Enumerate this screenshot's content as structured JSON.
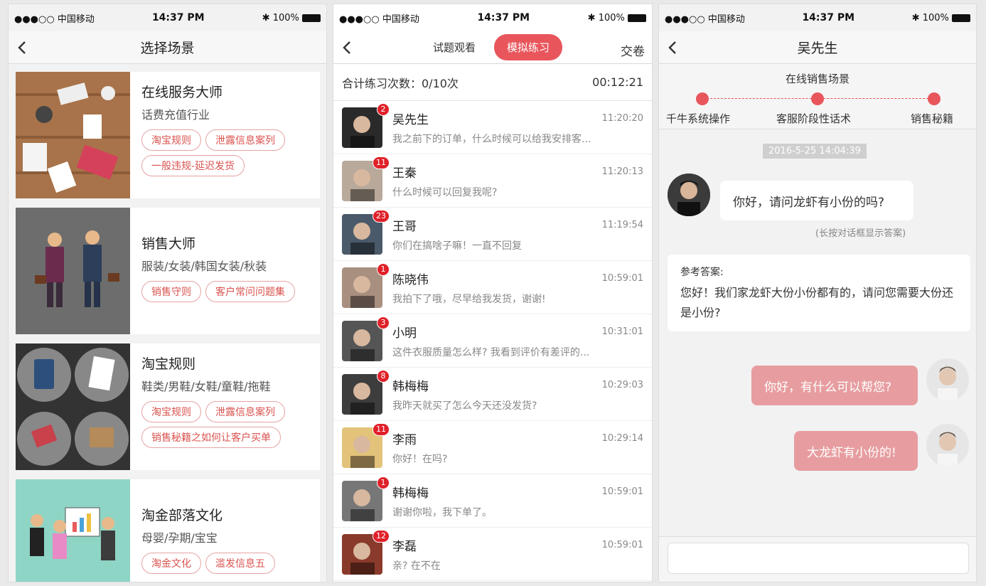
{
  "status": {
    "signal": "●●●○○ 中国移动",
    "time": "14:37 PM",
    "battery": "100%"
  },
  "panel1": {
    "title": "选择场景",
    "cards": [
      {
        "title": "在线服务大师",
        "sub": "话费充值行业",
        "tags": [
          "淘宝规则",
          "泄露信息案列",
          "一般违规-延迟发货"
        ]
      },
      {
        "title": "销售大师",
        "sub": "服装/女装/韩国女装/秋装",
        "tags": [
          "销售守则",
          "客户常问问题集"
        ]
      },
      {
        "title": "淘宝规则",
        "sub": "鞋类/男鞋/女鞋/童鞋/拖鞋",
        "tags": [
          "淘宝规则",
          "泄露信息案列",
          "销售秘籍之如何让客户买单"
        ]
      },
      {
        "title": "淘金部落文化",
        "sub": "母婴/孕期/宝宝",
        "tags": [
          "淘金文化",
          "滥发信息五"
        ]
      }
    ]
  },
  "panel2": {
    "tab1": "试题观看",
    "tab2": "模拟练习",
    "submit": "交卷",
    "count": "合计练习次数：0/10次",
    "timer": "00:12:21",
    "contacts": [
      {
        "name": "吴先生",
        "time": "11:20:20",
        "msg": "我之前下的订单，什么时候可以给我安排客...",
        "badge": "2"
      },
      {
        "name": "王秦",
        "time": "11:20:13",
        "msg": "什么时候可以回复我呢?",
        "badge": "11"
      },
      {
        "name": "王哥",
        "time": "11:19:54",
        "msg": "你们在搞啥子嘛！一直不回复",
        "badge": "23"
      },
      {
        "name": "陈晓伟",
        "time": "10:59:01",
        "msg": "我拍下了哦，尽早给我发货，谢谢!",
        "badge": "1"
      },
      {
        "name": "小明",
        "time": "10:31:01",
        "msg": "这件衣服质量怎么样? 我看到评价有差评的...",
        "badge": "3"
      },
      {
        "name": "韩梅梅",
        "time": "10:29:03",
        "msg": "我昨天就买了怎么今天还没发货?",
        "badge": "8"
      },
      {
        "name": "李雨",
        "time": "10:29:14",
        "msg": "你好！在吗?",
        "badge": "11"
      },
      {
        "name": "韩梅梅",
        "time": "10:59:01",
        "msg": "谢谢你啦，我下单了。",
        "badge": "1"
      },
      {
        "name": "李磊",
        "time": "10:59:01",
        "msg": "亲? 在不在",
        "badge": "12"
      }
    ]
  },
  "panel3": {
    "title": "吴先生",
    "scene": "在线销售场景",
    "steps": [
      "千牛系统操作",
      "客服阶段性话术",
      "销售秘籍"
    ],
    "timestamp": "2016-5-25 14:04:39",
    "msg_in": "你好，请问龙虾有小份的吗?",
    "hint": "(长按对话框显示答案)",
    "answer_head": "参考答案:",
    "answer_text": "您好！我们家龙虾大份小份都有的，请问您需要大份还是小份?",
    "msg_out1": "你好，有什么可以帮您?",
    "msg_out2": "大龙虾有小份的!"
  }
}
